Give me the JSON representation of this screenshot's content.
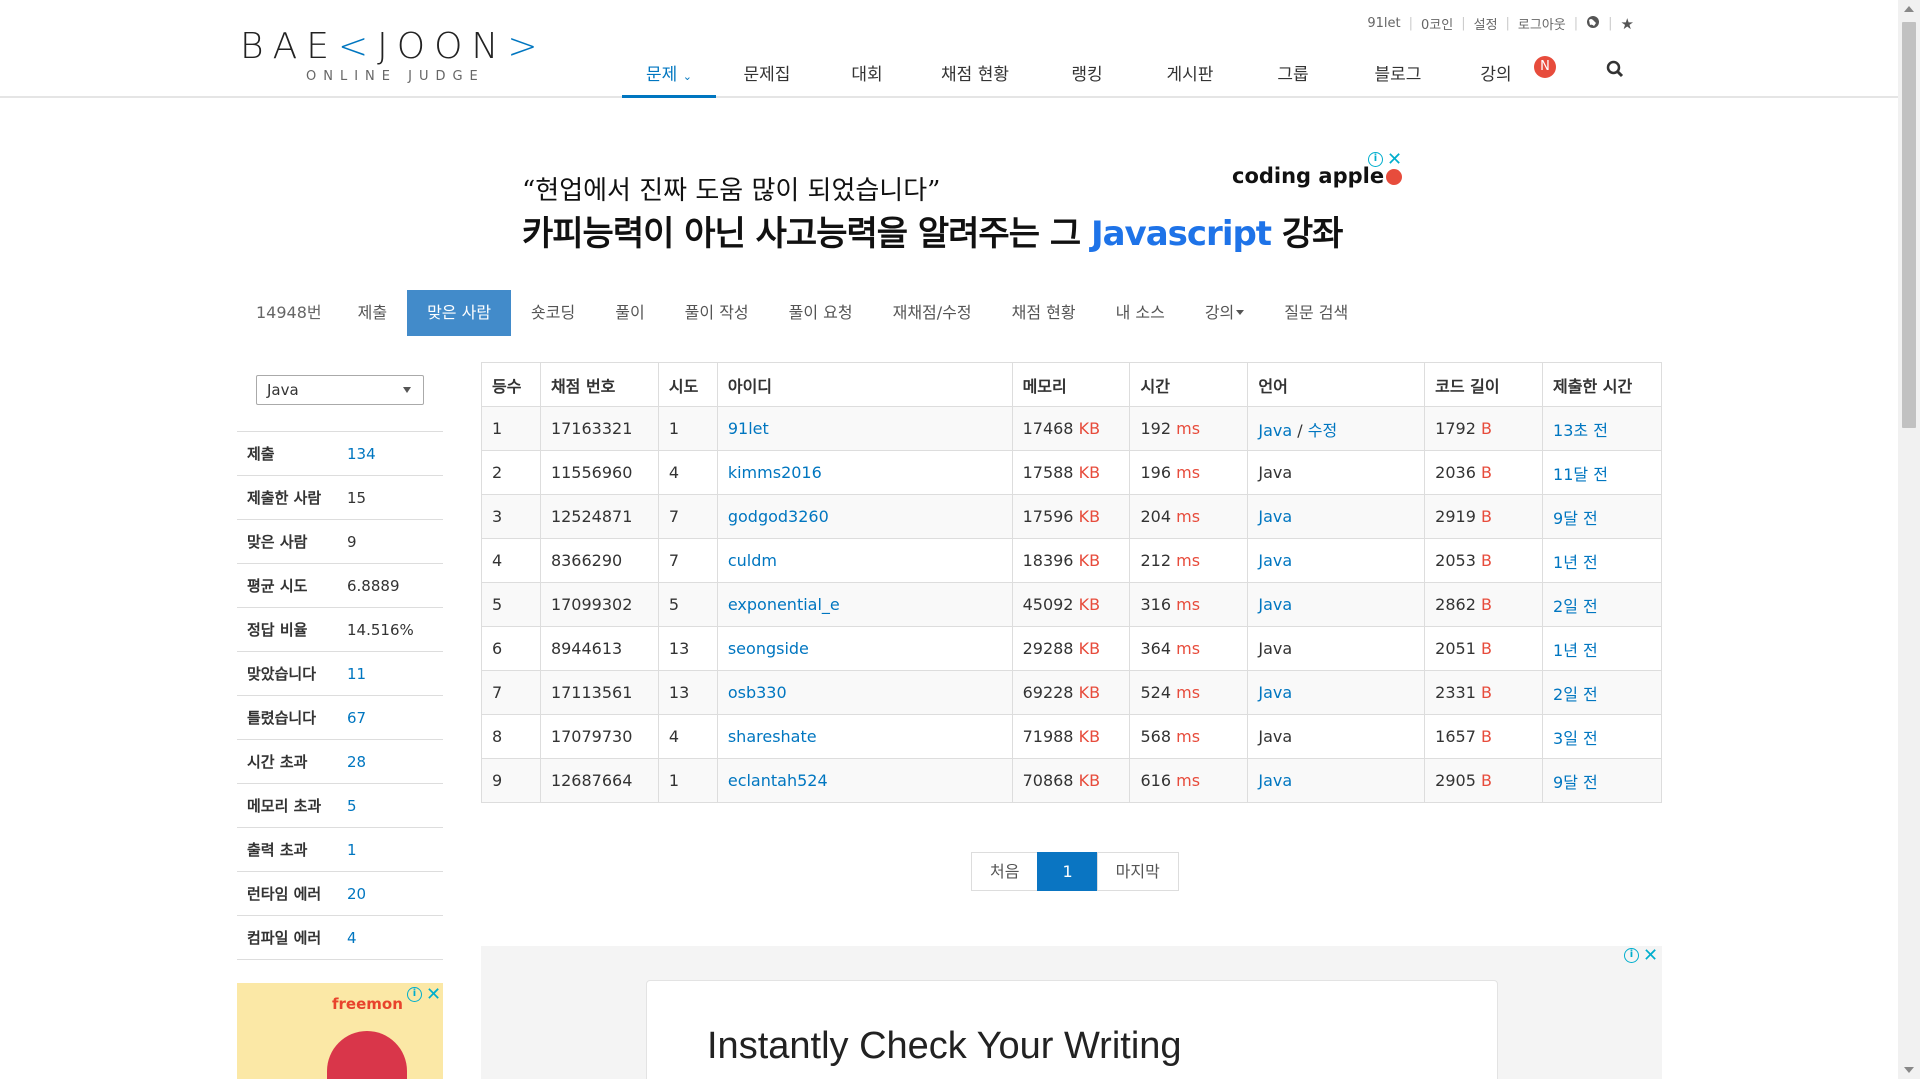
{
  "logo": {
    "main_left": "BAE",
    "main_bracket_l": "<",
    "main_mid": "JOON",
    "main_bracket_r": ">",
    "sub": "ONLINE JUDGE"
  },
  "toplinks": {
    "user": "91let",
    "coins": "0코인",
    "settings": "설정",
    "logout": "로그아웃"
  },
  "nav": {
    "items": [
      "문제",
      "문제집",
      "대회",
      "채점 현황",
      "랭킹",
      "게시판",
      "그룹",
      "블로그",
      "강의"
    ],
    "badge": "N",
    "active": "문제"
  },
  "top_ad": {
    "quote": "“현업에서 진짜 도움 많이 되었습니다”",
    "headline_pre": "카피능력이 아닌 사고능력을 알려주는 그 ",
    "headline_js": "Javascript",
    "headline_post": " 강좌",
    "brand": "coding apple"
  },
  "subtabs": [
    "14948번",
    "제출",
    "맞은 사람",
    "숏코딩",
    "풀이",
    "풀이 작성",
    "풀이 요청",
    "재채점/수정",
    "채점 현황",
    "내 소스",
    "강의",
    "질문 검색"
  ],
  "sidebar": {
    "language_select": "Java",
    "stats": [
      {
        "label": "제출",
        "value": "134",
        "link": true
      },
      {
        "label": "제출한 사람",
        "value": "15",
        "link": false
      },
      {
        "label": "맞은 사람",
        "value": "9",
        "link": false
      },
      {
        "label": "평균 시도",
        "value": "6.8889",
        "link": false
      },
      {
        "label": "정답 비율",
        "value": "14.516%",
        "link": false
      },
      {
        "label": "맞았습니다",
        "value": "11",
        "link": true
      },
      {
        "label": "틀렸습니다",
        "value": "67",
        "link": true
      },
      {
        "label": "시간 초과",
        "value": "28",
        "link": true
      },
      {
        "label": "메모리 초과",
        "value": "5",
        "link": true
      },
      {
        "label": "출력 초과",
        "value": "1",
        "link": true
      },
      {
        "label": "런타임 에러",
        "value": "20",
        "link": true
      },
      {
        "label": "컴파일 에러",
        "value": "4",
        "link": true
      }
    ],
    "ad_brand": "freemon"
  },
  "table": {
    "headers": [
      "등수",
      "채점 번호",
      "시도",
      "아이디",
      "메모리",
      "시간",
      "언어",
      "코드 길이",
      "제출한 시간"
    ],
    "mem_unit": "KB",
    "time_unit": "ms",
    "len_unit": "B",
    "edit_label": "수정",
    "rows": [
      {
        "rank": "1",
        "sub": "17163321",
        "tries": "1",
        "id": "91let",
        "mem": "17468",
        "time": "192",
        "lang": "Java",
        "lang_link": true,
        "edit": true,
        "len": "1792",
        "when": "13초 전"
      },
      {
        "rank": "2",
        "sub": "11556960",
        "tries": "4",
        "id": "kimms2016",
        "mem": "17588",
        "time": "196",
        "lang": "Java",
        "lang_link": false,
        "edit": false,
        "len": "2036",
        "when": "11달 전"
      },
      {
        "rank": "3",
        "sub": "12524871",
        "tries": "7",
        "id": "godgod3260",
        "mem": "17596",
        "time": "204",
        "lang": "Java",
        "lang_link": true,
        "edit": false,
        "len": "2919",
        "when": "9달 전"
      },
      {
        "rank": "4",
        "sub": "8366290",
        "tries": "7",
        "id": "culdm",
        "mem": "18396",
        "time": "212",
        "lang": "Java",
        "lang_link": true,
        "edit": false,
        "len": "2053",
        "when": "1년 전"
      },
      {
        "rank": "5",
        "sub": "17099302",
        "tries": "5",
        "id": "exponential_e",
        "mem": "45092",
        "time": "316",
        "lang": "Java",
        "lang_link": true,
        "edit": false,
        "len": "2862",
        "when": "2일 전"
      },
      {
        "rank": "6",
        "sub": "8944613",
        "tries": "13",
        "id": "seongside",
        "mem": "29288",
        "time": "364",
        "lang": "Java",
        "lang_link": false,
        "edit": false,
        "len": "2051",
        "when": "1년 전"
      },
      {
        "rank": "7",
        "sub": "17113561",
        "tries": "13",
        "id": "osb330",
        "mem": "69228",
        "time": "524",
        "lang": "Java",
        "lang_link": true,
        "edit": false,
        "len": "2331",
        "when": "2일 전"
      },
      {
        "rank": "8",
        "sub": "17079730",
        "tries": "4",
        "id": "shareshate",
        "mem": "71988",
        "time": "568",
        "lang": "Java",
        "lang_link": false,
        "edit": false,
        "len": "1657",
        "when": "3일 전"
      },
      {
        "rank": "9",
        "sub": "12687664",
        "tries": "1",
        "id": "eclantah524",
        "mem": "70868",
        "time": "616",
        "lang": "Java",
        "lang_link": true,
        "edit": false,
        "len": "2905",
        "when": "9달 전"
      }
    ]
  },
  "pager": {
    "first": "처음",
    "current": "1",
    "last": "마지막"
  },
  "bottom_ad": {
    "title": "Instantly Check Your Writing"
  },
  "colors": {
    "accent": "#0076c0",
    "active_tab": "#428bca",
    "unit_red": "#e74c3c",
    "pager_active": "#0a75c2"
  }
}
